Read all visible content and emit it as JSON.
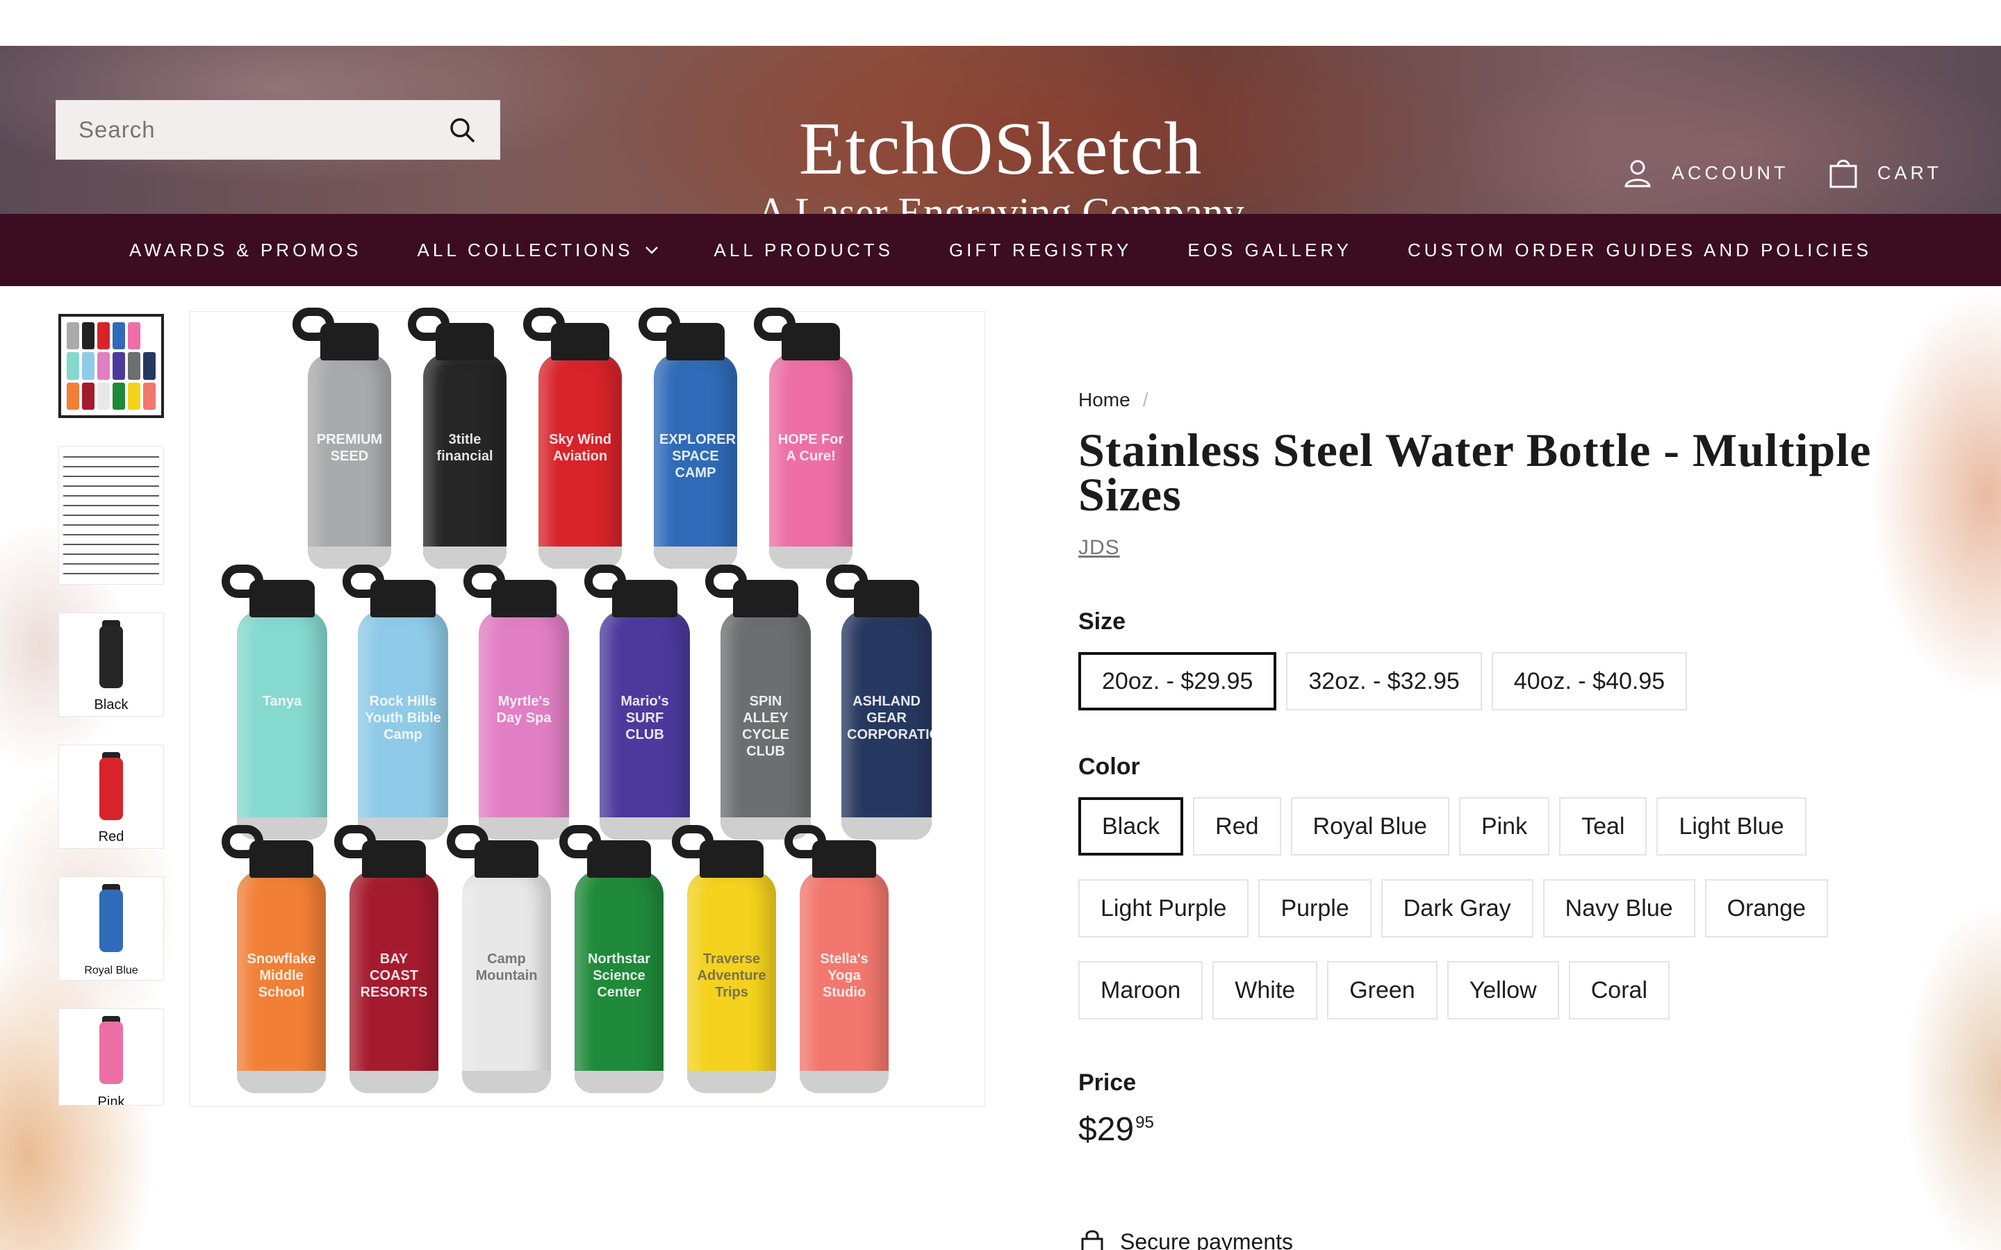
{
  "header": {
    "search_placeholder": "Search",
    "logo_name": "EtchOSketch",
    "logo_tagline": "A Laser Engraving Company",
    "account_label": "ACCOUNT",
    "cart_label": "CART"
  },
  "nav": {
    "items": [
      {
        "label": "AWARDS & PROMOS"
      },
      {
        "label": "ALL COLLECTIONS"
      },
      {
        "label": "ALL PRODUCTS"
      },
      {
        "label": "GIFT REGISTRY"
      },
      {
        "label": "EOS GALLERY"
      },
      {
        "label": "CUSTOM ORDER GUIDES AND POLICIES"
      }
    ]
  },
  "thumbnails": [
    {
      "label": ""
    },
    {
      "label": ""
    },
    {
      "label": "Black"
    },
    {
      "label": "Red"
    },
    {
      "label": "Royal Blue"
    },
    {
      "label": "Pink"
    }
  ],
  "main_image": {
    "bottles": [
      {
        "color": "#a9aaac",
        "text": "PREMIUM SEED"
      },
      {
        "color": "#262626",
        "text": "3title financial"
      },
      {
        "color": "#d8232a",
        "text": "Sky Wind Aviation"
      },
      {
        "color": "#2f6bb8",
        "text": "EXPLORER SPACE CAMP"
      },
      {
        "color": "#ee6ea6",
        "text": "HOPE For A Cure!"
      },
      {
        "color": "#86d9cf",
        "text": "Tanya"
      },
      {
        "color": "#8fcbe8",
        "text": "Rock Hills Youth Bible Camp"
      },
      {
        "color": "#e17fc4",
        "text": "Myrtle's Day Spa"
      },
      {
        "color": "#4b3a9c",
        "text": "Mario's SURF CLUB"
      },
      {
        "color": "#6d6e70",
        "text": "SPIN ALLEY CYCLE CLUB"
      },
      {
        "color": "#273860",
        "text": "ASHLAND GEAR CORPORATION"
      },
      {
        "color": "#f27f36",
        "text": "Snowflake Middle School"
      },
      {
        "color": "#a51b2e",
        "text": "BAY COAST RESORTS"
      },
      {
        "color": "#e8e8e8",
        "text": "Camp Mountain"
      },
      {
        "color": "#1f8a3a",
        "text": "Northstar Science Center"
      },
      {
        "color": "#f4d21d",
        "text": "Traverse Adventure Trips"
      },
      {
        "color": "#f2776e",
        "text": "Stella's Yoga Studio"
      }
    ]
  },
  "product": {
    "breadcrumb_home": "Home",
    "breadcrumb_sep": "/",
    "title": "Stainless Steel Water Bottle - Multiple Sizes",
    "vendor": "JDS",
    "size_label": "Size",
    "sizes": [
      {
        "label": "20oz. - $29.95",
        "selected": true
      },
      {
        "label": "32oz. - $32.95",
        "selected": false
      },
      {
        "label": "40oz. - $40.95",
        "selected": false
      }
    ],
    "color_label": "Color",
    "colors": [
      {
        "label": "Black",
        "selected": true
      },
      {
        "label": "Red"
      },
      {
        "label": "Royal Blue"
      },
      {
        "label": "Pink"
      },
      {
        "label": "Teal"
      },
      {
        "label": "Light Blue"
      },
      {
        "label": "Light Purple"
      },
      {
        "label": "Purple"
      },
      {
        "label": "Dark Gray"
      },
      {
        "label": "Navy Blue"
      },
      {
        "label": "Orange"
      },
      {
        "label": "Maroon"
      },
      {
        "label": "White"
      },
      {
        "label": "Green"
      },
      {
        "label": "Yellow"
      },
      {
        "label": "Coral"
      }
    ],
    "price_label": "Price",
    "price_whole": "$29",
    "price_cents": "95",
    "secure_payments": "Secure payments"
  },
  "colors": {
    "nav_bg": "#3c0d20",
    "accent_border": "#111111"
  }
}
